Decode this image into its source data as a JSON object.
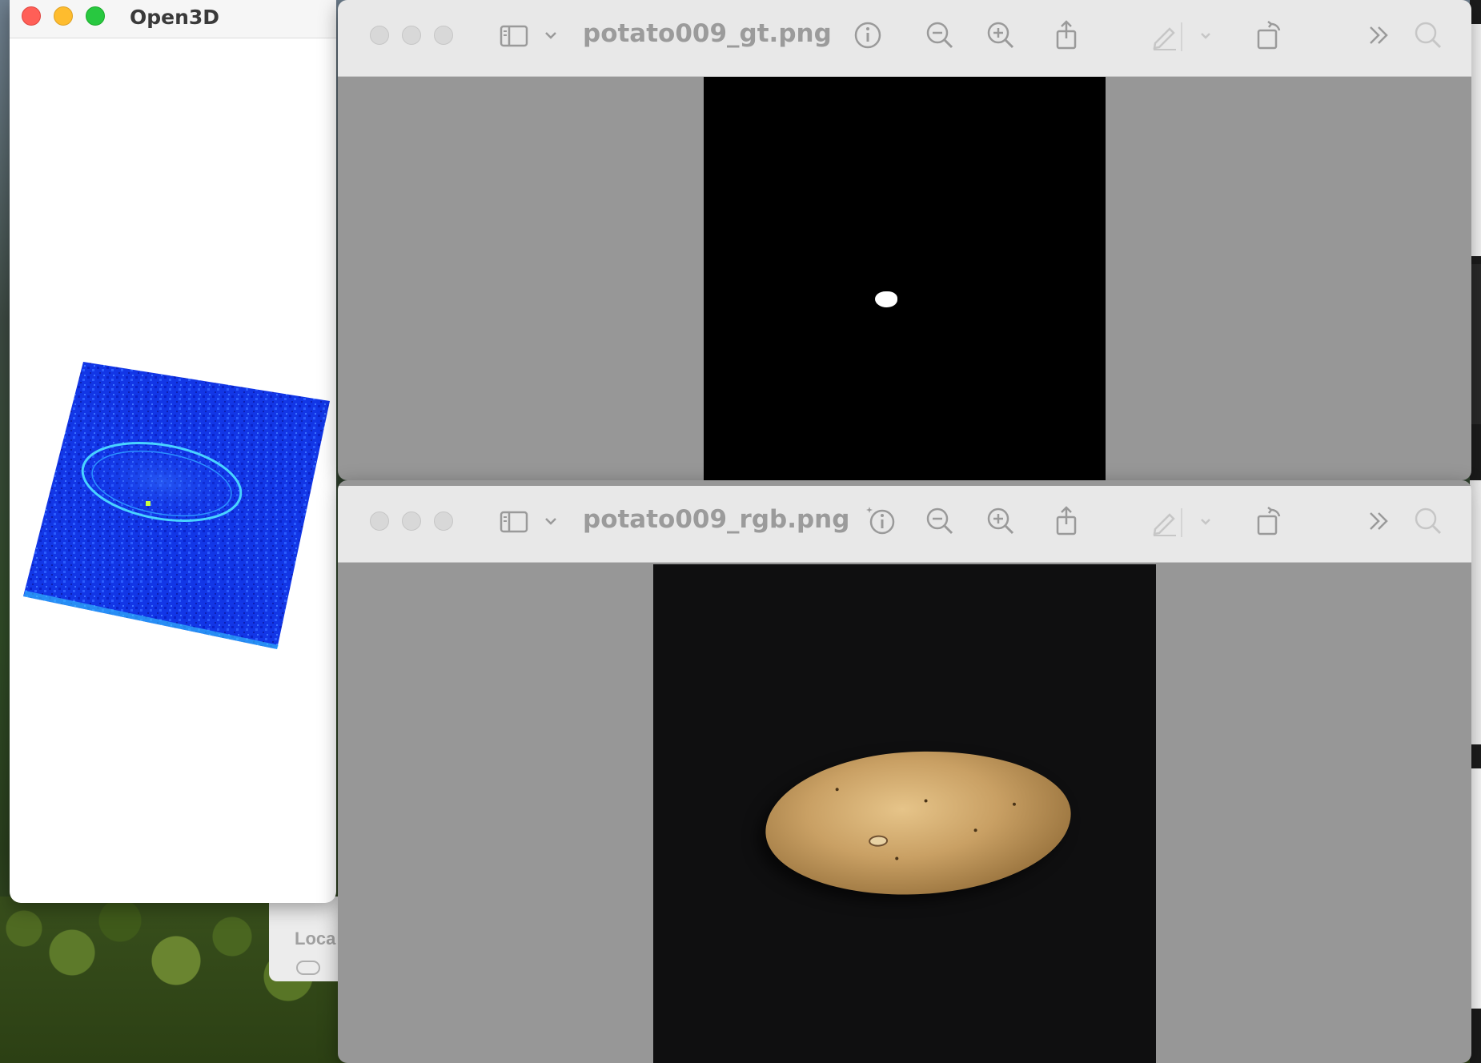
{
  "desktop": {
    "background_fragment_text": "Loca"
  },
  "open3d_window": {
    "title": "Open3D",
    "colors": {
      "heatmap_base": "#1030e0",
      "heatmap_highlight": "#20d8ff"
    }
  },
  "gt_window": {
    "title": "potato009_gt.png",
    "toolbar_icons": [
      "sidebar-icon",
      "chevron-down-icon",
      "info-icon",
      "zoom-out-icon",
      "zoom-in-icon",
      "share-icon",
      "markup-icon",
      "chevron-down-icon",
      "rotate-icon",
      "more-icon",
      "search-icon"
    ]
  },
  "rgb_window": {
    "title": "potato009_rgb.png",
    "toolbar_icons": [
      "sidebar-icon",
      "chevron-down-icon",
      "info-icon",
      "zoom-out-icon",
      "zoom-in-icon",
      "share-icon",
      "markup-icon",
      "chevron-down-icon",
      "rotate-icon",
      "more-icon",
      "search-icon"
    ]
  }
}
